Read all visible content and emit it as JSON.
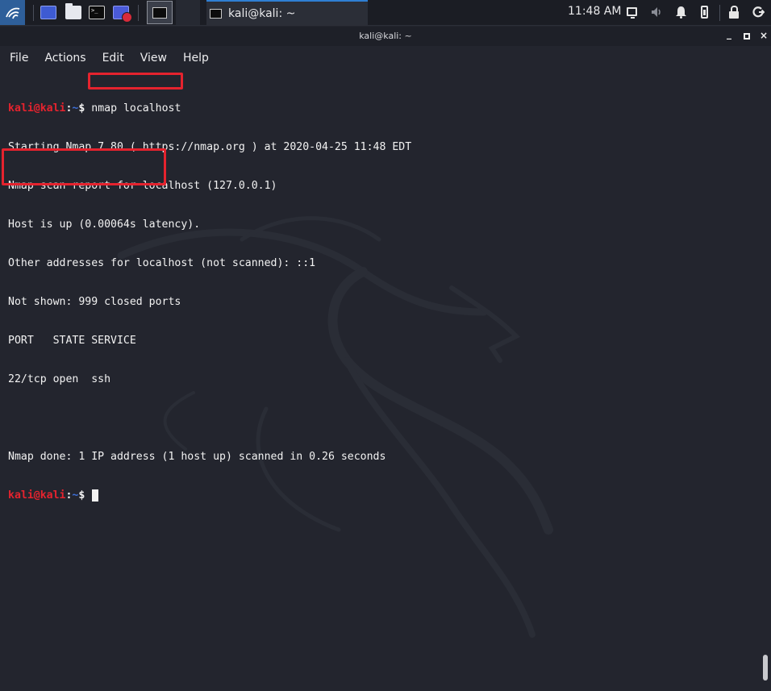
{
  "panel": {
    "task_label": "kali@kali: ~",
    "clock": "11:48 AM"
  },
  "window": {
    "title": "kali@kali: ~",
    "controls": {
      "minimize": "_",
      "close": "×"
    }
  },
  "menu": [
    "File",
    "Actions",
    "Edit",
    "View",
    "Help"
  ],
  "terminal": {
    "prompt": {
      "user": "kali@kali",
      "colon": ":",
      "path": "~",
      "dollar": "$"
    },
    "command": "nmap localhost",
    "output": [
      "Starting Nmap 7.80 ( https://nmap.org ) at 2020-04-25 11:48 EDT",
      "Nmap scan report for localhost (127.0.0.1)",
      "Host is up (0.00064s latency).",
      "Other addresses for localhost (not scanned): ::1",
      "Not shown: 999 closed ports",
      "PORT   STATE SERVICE",
      "22/tcp open  ssh",
      "",
      "Nmap done: 1 IP address (1 host up) scanned in 0.26 seconds"
    ],
    "colors": {
      "prompt_user": "#e5232e",
      "prompt_path": "#3e6fd8",
      "highlight": "#e5232e"
    }
  }
}
